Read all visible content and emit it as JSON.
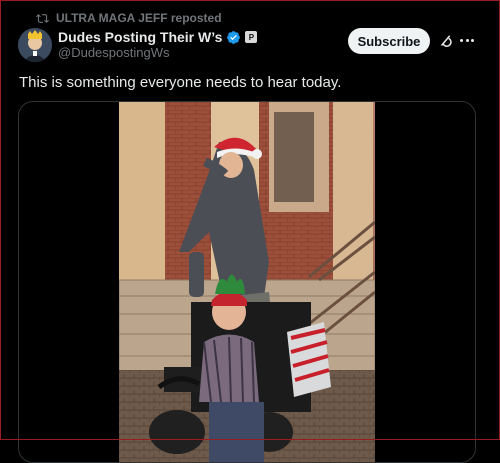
{
  "repost": {
    "label": "ULTRA MAGA JEFF reposted",
    "icon": "repost-icon"
  },
  "author": {
    "display_name": "Dudes Posting Their W’s",
    "handle": "@DudespostingWs",
    "verified_icon": "verified-badge-icon",
    "affiliate_badge": "P",
    "avatar_icon": "avatar-image"
  },
  "actions": {
    "subscribe_label": "Subscribe",
    "grok_icon": "grok-icon",
    "more_icon": "more-icon"
  },
  "tweet": {
    "text": "This is something everyone needs to hear today."
  },
  "media": {
    "type": "video",
    "description_icon": "video-frame"
  },
  "colors": {
    "background": "#000000",
    "text": "#e7e9ea",
    "secondary_text": "#71767b",
    "verified": "#1d9bf0",
    "button_bg": "#eff3f4"
  }
}
